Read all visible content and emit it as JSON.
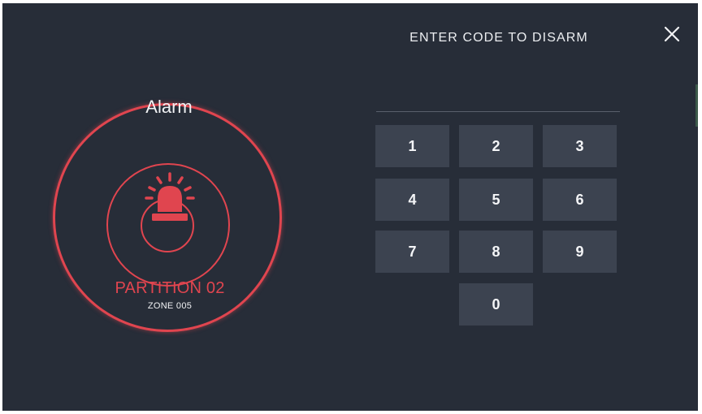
{
  "colors": {
    "background": "#272d38",
    "alarm_red": "#e0454f",
    "key_background": "#3c4350",
    "text": "#f1f2f4"
  },
  "alarm": {
    "status_label": "Alarm",
    "partition": "PARTITION 02",
    "zone": "ZONE 005",
    "icon": "siren-icon"
  },
  "keypad": {
    "title": "ENTER CODE TO DISARM",
    "code_value": "",
    "close_icon": "close-icon",
    "keys": [
      "1",
      "2",
      "3",
      "4",
      "5",
      "6",
      "7",
      "8",
      "9",
      "0"
    ]
  }
}
